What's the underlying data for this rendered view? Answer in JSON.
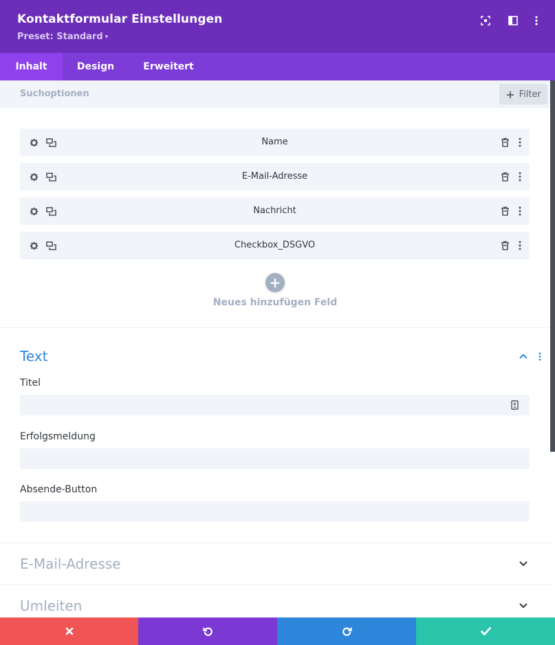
{
  "header": {
    "title": "Kontaktformular Einstellungen",
    "preset_label": "Preset: Standard",
    "bg_color": "#6c2eb9",
    "icons": [
      "fullscreen-icon",
      "sidebar-icon",
      "more-icon"
    ]
  },
  "tabs": [
    {
      "label": "Inhalt",
      "active": true
    },
    {
      "label": "Design",
      "active": false
    },
    {
      "label": "Erweitert",
      "active": false
    }
  ],
  "search": {
    "placeholder": "Suchoptionen",
    "filter_label": "Filter"
  },
  "fields": [
    {
      "label": "Name"
    },
    {
      "label": "E-Mail-Adresse"
    },
    {
      "label": "Nachricht"
    },
    {
      "label": "Checkbox_DSGVO"
    }
  ],
  "add_field": {
    "label": "Neues hinzufügen Feld"
  },
  "text_section": {
    "title": "Text",
    "inputs": [
      {
        "label": "Titel",
        "value": ""
      },
      {
        "label": "Erfolgsmeldung",
        "value": ""
      },
      {
        "label": "Absende-Button",
        "value": ""
      }
    ]
  },
  "collapsed_sections": [
    {
      "title": "E-Mail-Adresse"
    },
    {
      "title": "Umleiten"
    }
  ],
  "footer": {
    "buttons": [
      {
        "name": "cancel",
        "icon": "close-icon",
        "color": "#f05454"
      },
      {
        "name": "undo",
        "icon": "undo-icon",
        "color": "#7b38d3"
      },
      {
        "name": "redo",
        "icon": "redo-icon",
        "color": "#2e86da"
      },
      {
        "name": "save",
        "icon": "check-icon",
        "color": "#29c4a9"
      }
    ]
  },
  "colors": {
    "accent_blue": "#2b87da",
    "muted": "#a3b0c2",
    "row_bg": "#f1f4f9"
  }
}
